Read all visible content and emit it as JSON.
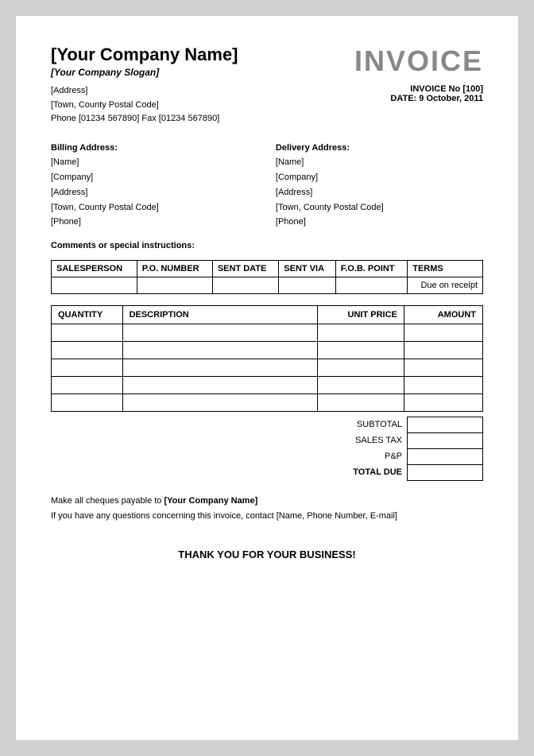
{
  "header": {
    "company_name": "[Your Company Name]",
    "company_slogan": "[Your Company Slogan]",
    "address_line1": "[Address]",
    "address_line2": "[Town, County Postal Code]",
    "address_line3": "Phone [01234 567890] Fax [01234 567890]",
    "invoice_title": "INVOICE",
    "invoice_no_label": "INVOICE No",
    "invoice_no_value": "[100]",
    "date_label": "DATE:",
    "date_value": "9 October, 2011"
  },
  "billing": {
    "title": "Billing Address:",
    "name": "[Name]",
    "company": "[Company]",
    "address": "[Address]",
    "town": "[Town, County Postal Code]",
    "phone": "[Phone]"
  },
  "delivery": {
    "title": "Delivery Address:",
    "name": "[Name]",
    "company": "[Company]",
    "address": "[Address]",
    "town": "[Town, County Postal Code]",
    "phone": "[Phone]"
  },
  "comments": {
    "label": "Comments or special instructions:"
  },
  "sales_table": {
    "headers": [
      "SALESPERSON",
      "P.O. NUMBER",
      "SENT DATE",
      "SENT VIA",
      "F.O.B. POINT",
      "TERMS"
    ],
    "row": {
      "salesperson": "",
      "po_number": "",
      "sent_date": "",
      "sent_via": "",
      "fob_point": "",
      "terms": "Due on receipt"
    }
  },
  "items_table": {
    "headers": {
      "quantity": "QUANTITY",
      "description": "DESCRIPTION",
      "unit_price": "UNIT PRICE",
      "amount": "AMOUNT"
    },
    "rows": [
      {
        "quantity": "",
        "description": "",
        "unit_price": "",
        "amount": ""
      },
      {
        "quantity": "",
        "description": "",
        "unit_price": "",
        "amount": ""
      },
      {
        "quantity": "",
        "description": "",
        "unit_price": "",
        "amount": ""
      },
      {
        "quantity": "",
        "description": "",
        "unit_price": "",
        "amount": ""
      },
      {
        "quantity": "",
        "description": "",
        "unit_price": "",
        "amount": ""
      }
    ]
  },
  "totals": {
    "subtotal_label": "SUBTOTAL",
    "sales_tax_label": "SALES TAX",
    "pnp_label": "P&P",
    "total_due_label": "TOTAL DUE"
  },
  "footer": {
    "note_part1": "Make all cheques payable to ",
    "note_bold": "[Your Company Name]",
    "note_part2": "\nIf you have any questions concerning this invoice, contact [Name, Phone Number, E-mail]",
    "thank_you": "THANK YOU FOR YOUR BUSINESS!"
  }
}
